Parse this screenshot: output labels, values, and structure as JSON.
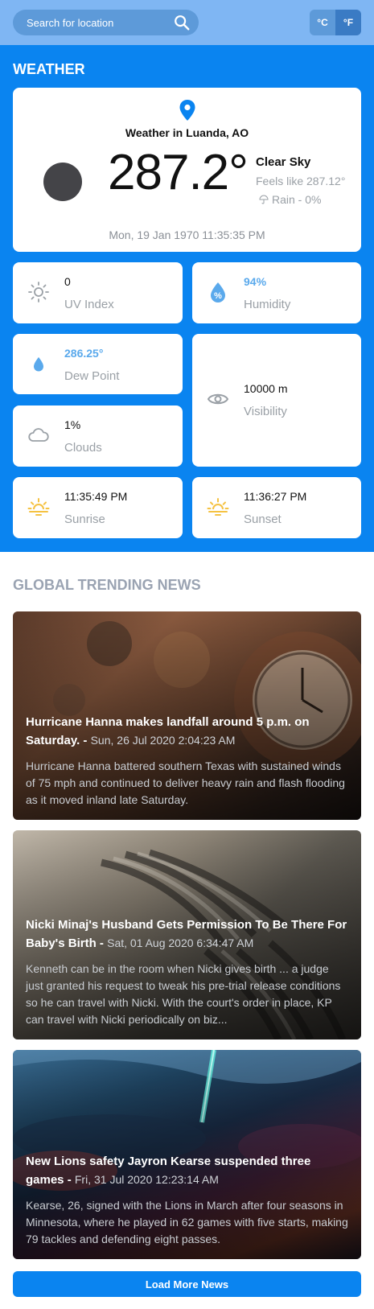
{
  "search": {
    "placeholder": "Search for location"
  },
  "units": {
    "celsius": "°C",
    "fahrenheit": "°F",
    "active": "fahrenheit"
  },
  "weather": {
    "section_title": "WEATHER",
    "location_title": "Weather in Luanda, AO",
    "temperature": "287.2°",
    "condition": "Clear Sky",
    "feels_like": "Feels like 287.12°",
    "rain": "Rain - 0%",
    "date": "Mon, 19 Jan 1970 11:35:35 PM",
    "stats": {
      "uv": {
        "value": "0",
        "label": "UV Index"
      },
      "humidity": {
        "value": "94%",
        "label": "Humidity"
      },
      "dew_point": {
        "value": "286.25°",
        "label": "Dew Point"
      },
      "visibility": {
        "value": "10000 m",
        "label": "Visibility"
      },
      "clouds": {
        "value": "1%",
        "label": "Clouds"
      },
      "sunrise": {
        "value": "11:35:49 PM",
        "label": "Sunrise"
      },
      "sunset": {
        "value": "11:36:27 PM",
        "label": "Sunset"
      }
    }
  },
  "news": {
    "section_title": "GLOBAL TRENDING NEWS",
    "items": [
      {
        "title": "Hurricane Hanna makes landfall around 5 p.m. on Saturday.",
        "date": "Sun, 26 Jul 2020 2:04:23 AM",
        "description": "Hurricane Hanna battered southern Texas with sustained winds of 75 mph and continued to deliver heavy rain and flash flooding as it moved inland late Saturday."
      },
      {
        "title": "Nicki Minaj's Husband Gets Permission To Be There For Baby's Birth",
        "date": "Sat, 01 Aug 2020 6:34:47 AM",
        "description": "Kenneth can be in the room when Nicki gives birth ... a judge just granted his request to tweak his pre-trial release conditions so he can travel with Nicki. With the court's order in place, KP can travel with Nicki periodically on biz..."
      },
      {
        "title": "New Lions safety Jayron Kearse suspended three games",
        "date": "Fri, 31 Jul 2020 12:23:14 AM",
        "description": "Kearse, 26, signed with the Lions in March after four seasons in Minnesota, where he played in 62 games with five starts, making 79 tackles and defending eight passes."
      }
    ],
    "load_more": "Load More News"
  },
  "colors": {
    "primary": "#0a84f0",
    "topbar": "#7fb6f3",
    "accent_blue": "#5aa9ec",
    "sun_yellow": "#f5c242",
    "muted_text": "#9aa0a6"
  },
  "icons": [
    "search-icon",
    "location-pin-icon",
    "moon-icon",
    "umbrella-icon",
    "sun-icon",
    "humidity-drop-icon",
    "dew-drop-icon",
    "eye-icon",
    "cloud-icon",
    "sunrise-icon",
    "sunset-icon"
  ]
}
